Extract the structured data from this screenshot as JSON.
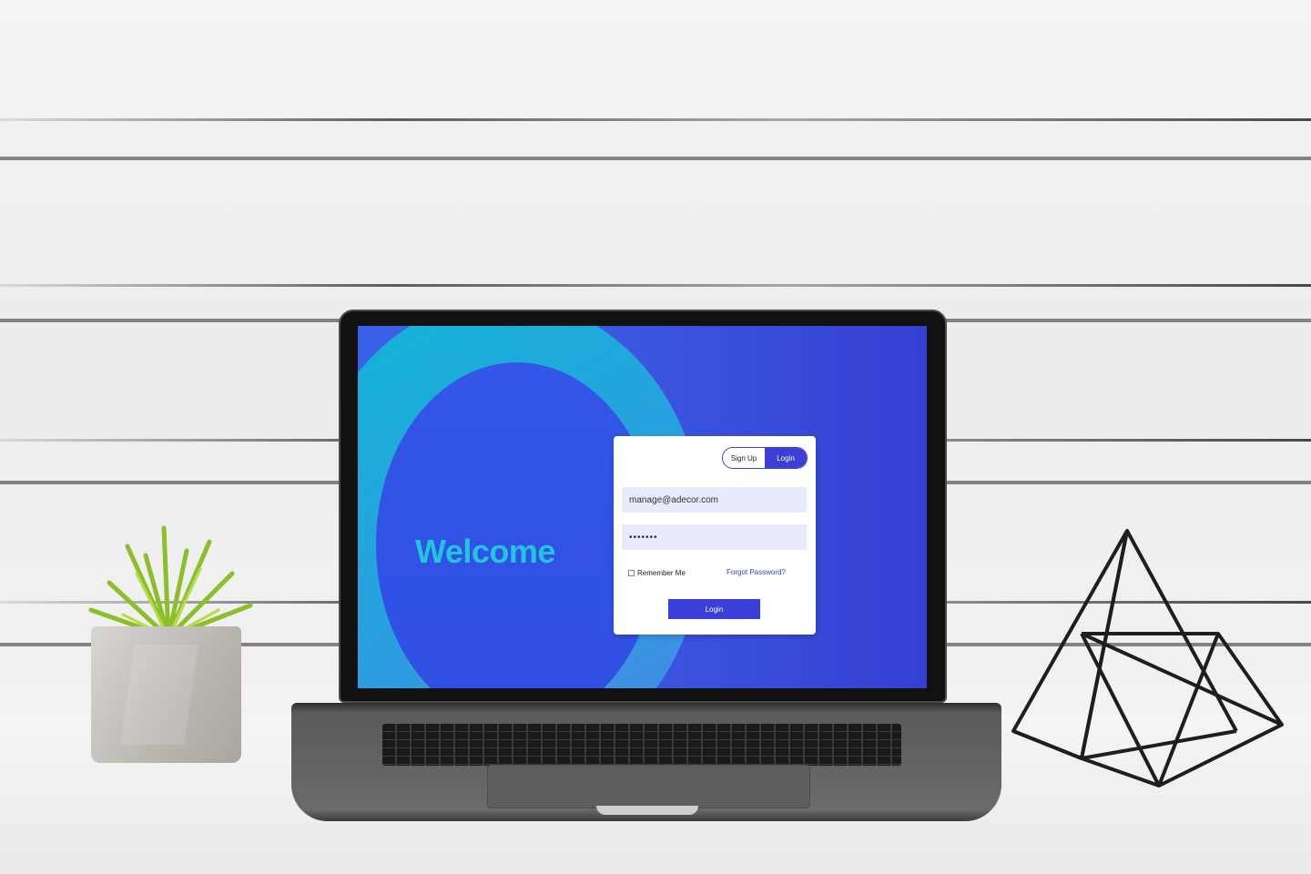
{
  "welcome": {
    "title": "Welcome"
  },
  "auth_toggle": {
    "signup_label": "Sign Up",
    "login_label": "Login",
    "active": "login"
  },
  "form": {
    "email_value": "manage@adecor.com",
    "password_value": "•••••••",
    "remember_label": "Remember Me",
    "remember_checked": false,
    "forgot_label": "Forgot Password?",
    "submit_label": "Login"
  },
  "colors": {
    "accent": "#3a3fd6",
    "welcome_text": "#22c5dd",
    "screen_bg": "#3a55e0",
    "ring": "#12b6d6",
    "field_bg": "#e8ebfb"
  }
}
